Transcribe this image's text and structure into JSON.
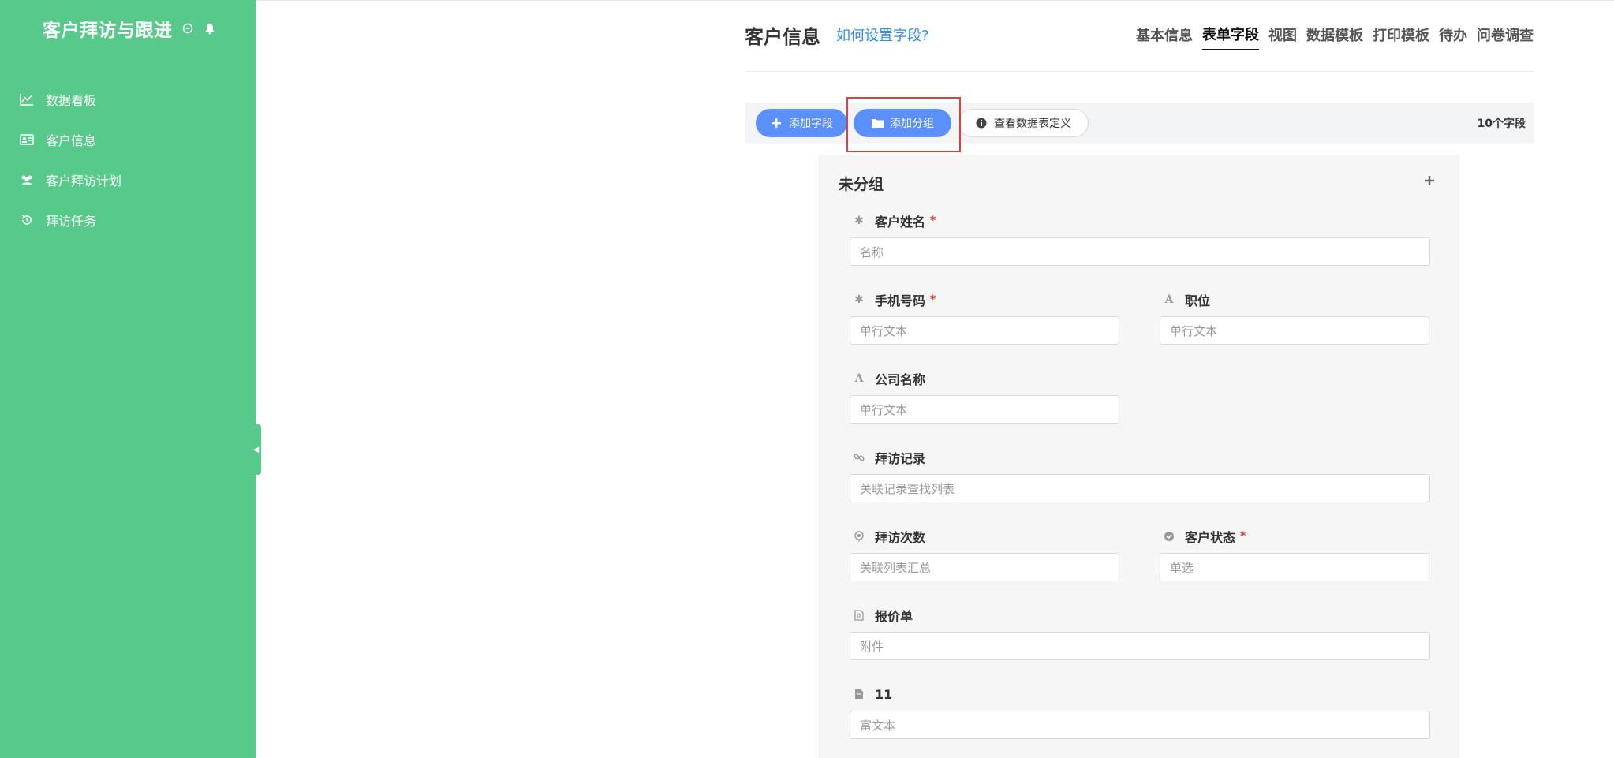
{
  "app": {
    "title": "客户拜访与跟进"
  },
  "sidebar": {
    "items": [
      {
        "label": "数据看板",
        "icon": "line-chart-icon"
      },
      {
        "label": "客户信息",
        "icon": "id-card-icon"
      },
      {
        "label": "客户拜访计划",
        "icon": "users-icon"
      },
      {
        "label": "拜访任务",
        "icon": "history-icon"
      }
    ]
  },
  "header": {
    "title": "客户信息",
    "help_link": "如何设置字段?",
    "tabs": [
      "基本信息",
      "表单字段",
      "视图",
      "数据模板",
      "打印模板",
      "待办",
      "问卷调查"
    ],
    "active_tab": "表单字段"
  },
  "toolbar": {
    "add_field": "添加字段",
    "add_group": "添加分组",
    "view_definition": "查看数据表定义",
    "field_count": "10个字段"
  },
  "group": {
    "title": "未分组",
    "fields": [
      {
        "label": "客户姓名",
        "placeholder": "名称",
        "icon": "asterisk-icon",
        "required": "*"
      },
      {
        "label": "手机号码",
        "placeholder": "单行文本",
        "icon": "asterisk-icon",
        "required": "*"
      },
      {
        "label": "职位",
        "placeholder": "单行文本",
        "icon": "text-a-icon",
        "required": ""
      },
      {
        "label": "公司名称",
        "placeholder": "单行文本",
        "icon": "text-a-icon",
        "required": ""
      },
      {
        "label": "拜访记录",
        "placeholder": "关联记录查找列表",
        "icon": "link-icon",
        "required": ""
      },
      {
        "label": "拜访次数",
        "placeholder": "关联列表汇总",
        "icon": "sigma-icon",
        "required": ""
      },
      {
        "label": "客户状态",
        "placeholder": "单选",
        "icon": "check-circle-icon",
        "required": "*"
      },
      {
        "label": "报价单",
        "placeholder": "附件",
        "icon": "attachment-icon",
        "required": ""
      },
      {
        "label": "11",
        "placeholder": "富文本",
        "icon": "document-icon",
        "required": ""
      }
    ]
  },
  "colors": {
    "sidebar": "#57c98a",
    "primary_button": "#5b8ff9",
    "link": "#2d8cf0",
    "highlight": "#e0403a",
    "required": "#e53935"
  }
}
